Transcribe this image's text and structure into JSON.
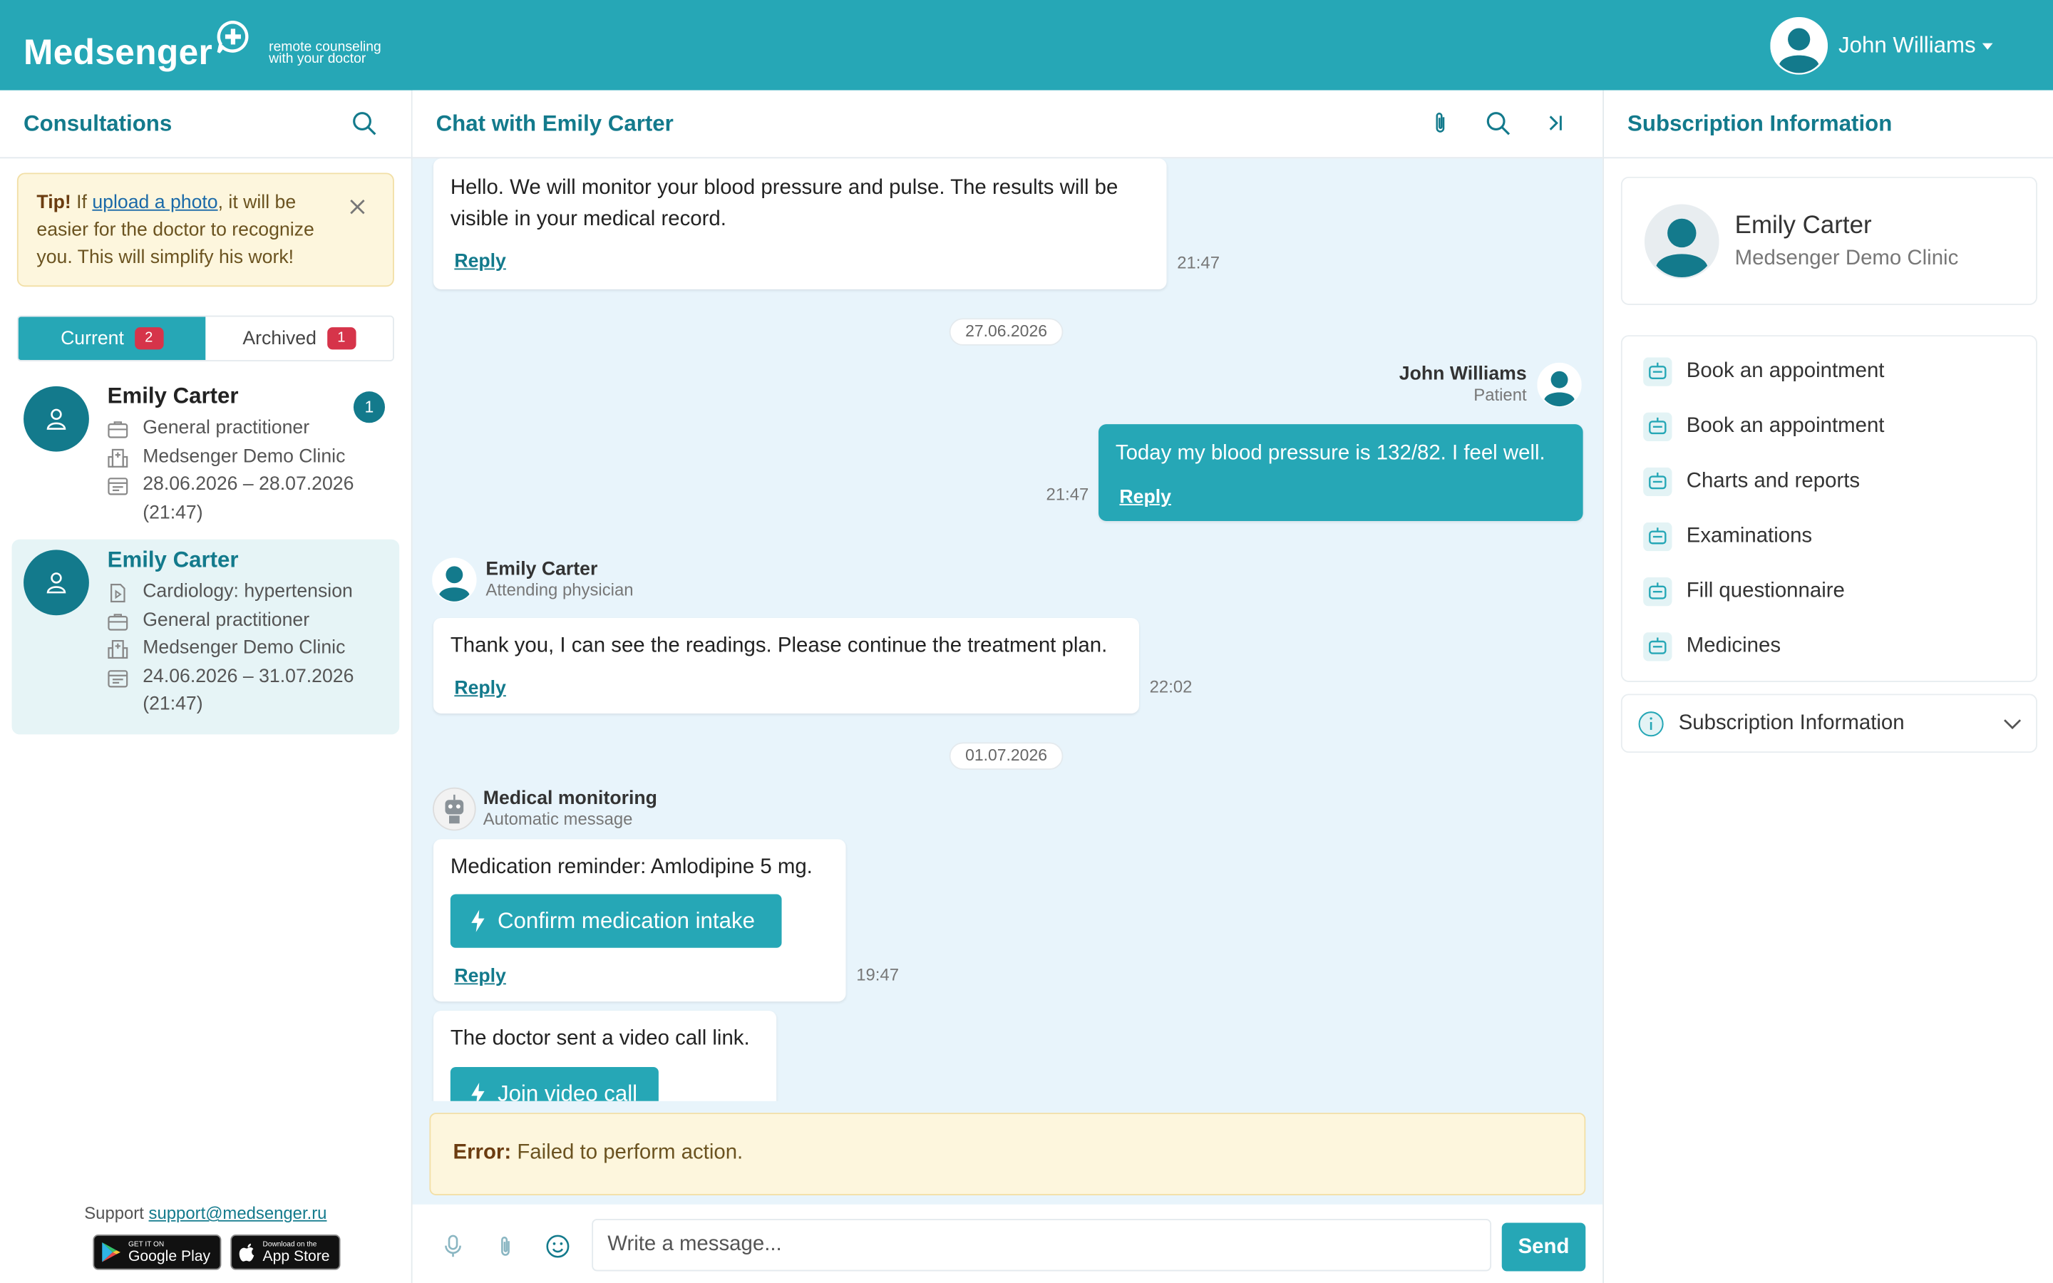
{
  "header": {
    "logo_text": "Medsenger",
    "tagline_line1": "remote counseling",
    "tagline_line2": "with your doctor",
    "user_name": "John Williams"
  },
  "left": {
    "title": "Consultations",
    "tip": {
      "bold": "Tip!",
      "pre": "If",
      "link": "upload a photo",
      "post": ", it will be easier for the doctor to recognize you. This will simplify his work!"
    },
    "tabs": [
      {
        "label": "Current",
        "count": "2"
      },
      {
        "label": "Archived",
        "count": "1"
      }
    ],
    "consultations": [
      {
        "name": "Emily Carter",
        "unread": "1",
        "specialty": "General practitioner",
        "clinic": "Medsenger Demo Clinic",
        "period": "28.06.2026 – 28.07.2026 (21:47)"
      },
      {
        "name": "Emily Carter",
        "program": "Cardiology: hypertension",
        "specialty": "General practitioner",
        "clinic": "Medsenger Demo Clinic",
        "period": "24.06.2026 – 31.07.2026 (21:47)"
      }
    ],
    "support_label": "Support",
    "support_email": "support@medsenger.ru",
    "google_small": "GET IT ON",
    "google_big": "Google Play",
    "apple_small": "Download on the",
    "apple_big": "App Store"
  },
  "chat": {
    "title": "Chat with Emily Carter",
    "reply_label": "Reply",
    "messages": [
      {
        "text": "Hello. We will monitor your blood pressure and pulse. The results will be visible in your medical record.",
        "time": "21:47"
      },
      {
        "date": "27.06.2026"
      },
      {
        "sender": "John Williams",
        "role": "Patient",
        "text": "Today my blood pressure is 132/82. I feel well.",
        "time": "21:47"
      },
      {
        "sender": "Emily Carter",
        "role": "Attending physician",
        "text": "Thank you, I can see the readings. Please continue the treatment plan.",
        "time": "22:02"
      },
      {
        "date": "01.07.2026"
      },
      {
        "sender": "Medical monitoring",
        "role": "Automatic message",
        "text": "Medication reminder: Amlodipine 5 mg.",
        "button": "Confirm medication intake",
        "time": "19:47"
      },
      {
        "text": "The doctor sent a video call link.",
        "button": "Join video call"
      }
    ],
    "error_bold": "Error:",
    "error_text": "Failed to perform action.",
    "input_placeholder": "Write a message...",
    "send_label": "Send"
  },
  "right": {
    "title": "Subscription Information",
    "doctor_name": "Emily Carter",
    "doctor_clinic": "Medsenger Demo Clinic",
    "menu": [
      "Book an appointment",
      "Book an appointment",
      "Charts and reports",
      "Examinations",
      "Fill questionnaire",
      "Medicines"
    ],
    "info_label": "Subscription Information"
  },
  "colors": {
    "brand": "#26a7b6",
    "brand_dark": "#137a8c",
    "badge_red": "#d6344a",
    "warning_bg": "#fdf6dd",
    "chat_bg": "#e8f4fb"
  }
}
